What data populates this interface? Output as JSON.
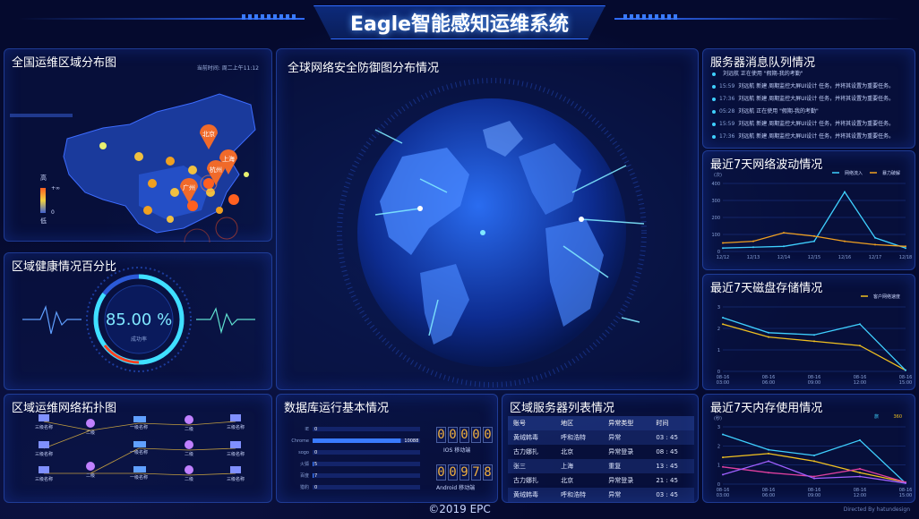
{
  "header": {
    "title": "Eagle智能感知运维系统"
  },
  "map_panel": {
    "title": "全国运维区域分布图",
    "time_label": "当前时间: 周二上午11:12",
    "legend_high": "高",
    "legend_low": "低",
    "legend_max": "+∞",
    "legend_min": "0",
    "cities": [
      "北京",
      "上海",
      "杭州",
      "广州"
    ]
  },
  "health_panel": {
    "title": "区域健康情况百分比",
    "percent": "85.00 %",
    "sub_label": "成功率",
    "success_rate": 0.85
  },
  "topology_panel": {
    "title": "区域运维网络拓扑图",
    "nodes": [
      "三级名称",
      "三级名称",
      "三级名称",
      "二级",
      "二级",
      "一级名称",
      "一级名称",
      "一级名称",
      "二级",
      "二级",
      "二级",
      "三级名称",
      "三级名称",
      "三级名称"
    ]
  },
  "globe_panel": {
    "title": "全球网络安全防御图分布情况"
  },
  "db_panel": {
    "title": "数据库运行基本情况",
    "rows": [
      {
        "label": "IE",
        "value": "0",
        "ratio": 0
      },
      {
        "label": "Chrome",
        "value": "10088",
        "ratio": 0.82
      },
      {
        "label": "sogo",
        "value": "0",
        "ratio": 0
      },
      {
        "label": "火狐",
        "value": "5",
        "ratio": 0.01
      },
      {
        "label": "百度",
        "value": "7",
        "ratio": 0.01
      },
      {
        "label": "猎豹",
        "value": "0",
        "ratio": 0
      }
    ],
    "ios_count": "00000",
    "ios_label": "IOS 移动端",
    "android_count": "00978",
    "android_label": "Android 移动端"
  },
  "server_list_panel": {
    "title": "区域服务器列表情况",
    "headers": [
      "账号",
      "地区",
      "异常类型",
      "时间"
    ],
    "rows": [
      [
        "黄绒韩毒",
        "呼和浩特",
        "异常",
        "03 : 45"
      ],
      [
        "古力娜扎",
        "北京",
        "异常登录",
        "08 : 45"
      ],
      [
        "张三",
        "上海",
        "重复",
        "13 : 45"
      ],
      [
        "古力娜扎",
        "北京",
        "异常登录",
        "21 : 45"
      ],
      [
        "黄绒韩毒",
        "呼和浩特",
        "异常",
        "03 : 45"
      ]
    ]
  },
  "queue_panel": {
    "title": "服务器消息队列情况",
    "items": [
      {
        "time": "",
        "text": "刘远航 正在使用 \"假期-我的考勤\""
      },
      {
        "time": "15:59",
        "text": "刘远航 新建 周期监控大屏UI设计 任务，并将其设置为重要任务。"
      },
      {
        "time": "17:36",
        "text": "刘远航 新建 周期监控大屏UI设计 任务，并将其设置为重要任务。"
      },
      {
        "time": "05:28",
        "text": "刘远航 正在使用 \"假期-我的考勤\""
      },
      {
        "time": "15:59",
        "text": "刘远航 新建 周期监控大屏UI设计 任务，并将其设置为重要任务。"
      },
      {
        "time": "17:36",
        "text": "刘远航 新建 周期监控大屏UI设计 任务，并将其设置为重要任务。"
      }
    ]
  },
  "colors": {
    "cyan": "#3fd0ff",
    "orange": "#f0a020",
    "pink": "#e040a0",
    "green": "#60e0a0",
    "purple": "#a060ff"
  },
  "chart_data": [
    {
      "type": "line",
      "title": "最近7天网络波动情况",
      "ylabel": "(次)",
      "categories": [
        "12/12",
        "12/13",
        "12/14",
        "12/15",
        "12/16",
        "12/17",
        "12/18"
      ],
      "ylim": [
        0,
        400
      ],
      "yticks": [
        "400",
        "300",
        "200",
        "100",
        "0"
      ],
      "series": [
        {
          "name": "网络流入",
          "color": "#3fd0ff",
          "values": [
            20,
            25,
            30,
            60,
            350,
            80,
            20
          ]
        },
        {
          "name": "暴力破解",
          "color": "#f0a020",
          "values": [
            50,
            60,
            110,
            90,
            60,
            40,
            30
          ]
        }
      ]
    },
    {
      "type": "line",
      "title": "最近7天磁盘存储情况",
      "categories": [
        "08-16\n03:00",
        "08-16\n06:00",
        "08-16\n09:00",
        "08-16\n12:00",
        "08-16\n15:00"
      ],
      "ylim": [
        0,
        3
      ],
      "yticks": [
        "3",
        "2",
        "1",
        "0"
      ],
      "series": [
        {
          "name": "客户网络速度",
          "color": "#f0c020",
          "values": [
            2.2,
            1.6,
            1.4,
            1.2,
            0.05
          ]
        },
        {
          "name": "",
          "color": "#3fd0ff",
          "values": [
            2.5,
            1.8,
            1.7,
            2.2,
            0.05
          ]
        }
      ]
    },
    {
      "type": "line",
      "title": "最近7天内存使用情况",
      "ylabel": "(秒)",
      "categories": [
        "08-16\n03:00",
        "08-16\n06:00",
        "08-16\n09:00",
        "08-16\n12:00",
        "08-16\n15:00"
      ],
      "ylim": [
        0,
        3
      ],
      "yticks": [
        "3",
        "2",
        "1",
        "0"
      ],
      "legend": [
        "旅",
        "360"
      ],
      "series": [
        {
          "name": "",
          "color": "#3fd0ff",
          "values": [
            2.6,
            1.8,
            1.5,
            2.3,
            0.05
          ]
        },
        {
          "name": "",
          "color": "#f0c020",
          "values": [
            1.4,
            1.6,
            1.2,
            0.6,
            0.1
          ]
        },
        {
          "name": "",
          "color": "#e040a0",
          "values": [
            0.9,
            0.6,
            0.4,
            0.8,
            0.1
          ]
        },
        {
          "name": "",
          "color": "#a060ff",
          "values": [
            0.5,
            1.2,
            0.3,
            0.4,
            0.05
          ]
        }
      ]
    }
  ],
  "footer": {
    "copyright": "©2019 EPC",
    "credit": "Directed By hatundesign"
  }
}
